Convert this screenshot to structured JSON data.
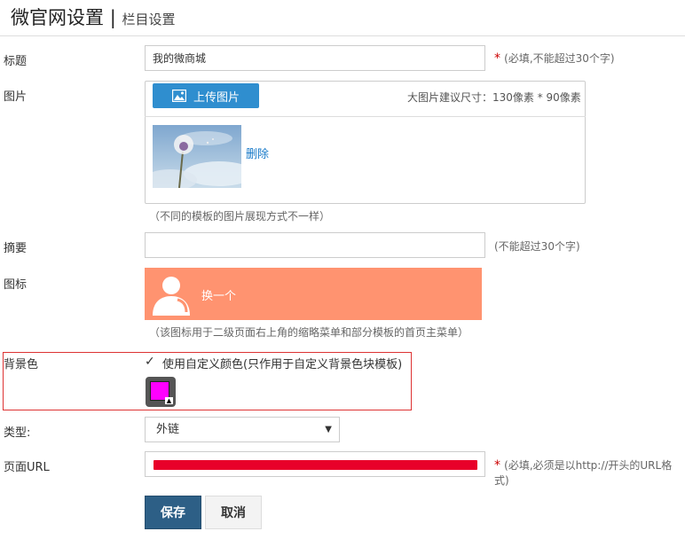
{
  "header": {
    "title": "微官网设置",
    "separator": "|",
    "subtitle": "栏目设置"
  },
  "fields": {
    "title": {
      "label": "标题",
      "value": "我的微商城",
      "required_mark": "*",
      "hint": "(必填,不能超过30个字)"
    },
    "image": {
      "label": "图片",
      "upload_label": "上传图片",
      "size_hint": "大图片建议尺寸：130像素 * 90像素",
      "delete_label": "删除",
      "note": "（不同的模板的图片展现方式不一样）"
    },
    "summary": {
      "label": "摘要",
      "value": "",
      "hint": "(不能超过30个字)"
    },
    "icon": {
      "label": "图标",
      "change_label": "换一个",
      "note": "（该图标用于二级页面右上角的缩略菜单和部分模板的首页主菜单）",
      "banner_color": "#ff9370"
    },
    "bg_color": {
      "label": "背景色",
      "checkbox_label": "使用自定义颜色(只作用于自定义背景色块模板)",
      "checked": true,
      "color": "#ff00ff"
    },
    "type": {
      "label": "类型:",
      "selected": "外链"
    },
    "url": {
      "label": "页面URL",
      "required_mark": "*",
      "hint": "(必填,必须是以http://开头的URL格式)"
    }
  },
  "actions": {
    "save_label": "保存",
    "cancel_label": "取消"
  }
}
